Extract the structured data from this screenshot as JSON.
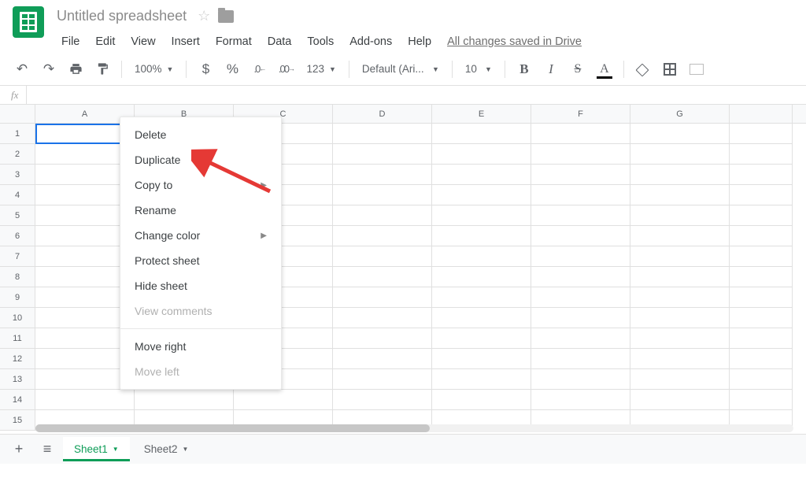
{
  "header": {
    "title": "Untitled spreadsheet",
    "menu": [
      "File",
      "Edit",
      "View",
      "Insert",
      "Format",
      "Data",
      "Tools",
      "Add-ons",
      "Help"
    ],
    "save_status": "All changes saved in Drive"
  },
  "toolbar": {
    "zoom": "100%",
    "currency": "$",
    "percent": "%",
    "dec_dec": ".0",
    "dec_inc": ".00",
    "num_format": "123",
    "font": "Default (Ari...",
    "font_size": "10",
    "bold": "B",
    "italic": "I",
    "strike": "S",
    "text_color": "A"
  },
  "columns": [
    "A",
    "B",
    "C",
    "D",
    "E",
    "F",
    "G"
  ],
  "rows": [
    "1",
    "2",
    "3",
    "4",
    "5",
    "6",
    "7",
    "8",
    "9",
    "10",
    "11",
    "12",
    "13",
    "14",
    "15"
  ],
  "sheet_tabs": [
    {
      "label": "Sheet1",
      "active": true
    },
    {
      "label": "Sheet2",
      "active": false
    }
  ],
  "context_menu": [
    {
      "label": "Delete",
      "type": "item"
    },
    {
      "label": "Duplicate",
      "type": "item"
    },
    {
      "label": "Copy to",
      "type": "submenu"
    },
    {
      "label": "Rename",
      "type": "item"
    },
    {
      "label": "Change color",
      "type": "submenu"
    },
    {
      "label": "Protect sheet",
      "type": "item"
    },
    {
      "label": "Hide sheet",
      "type": "item"
    },
    {
      "label": "View comments",
      "type": "disabled"
    },
    {
      "type": "sep"
    },
    {
      "label": "Move right",
      "type": "item"
    },
    {
      "label": "Move left",
      "type": "disabled"
    }
  ],
  "fx_label": "fx"
}
